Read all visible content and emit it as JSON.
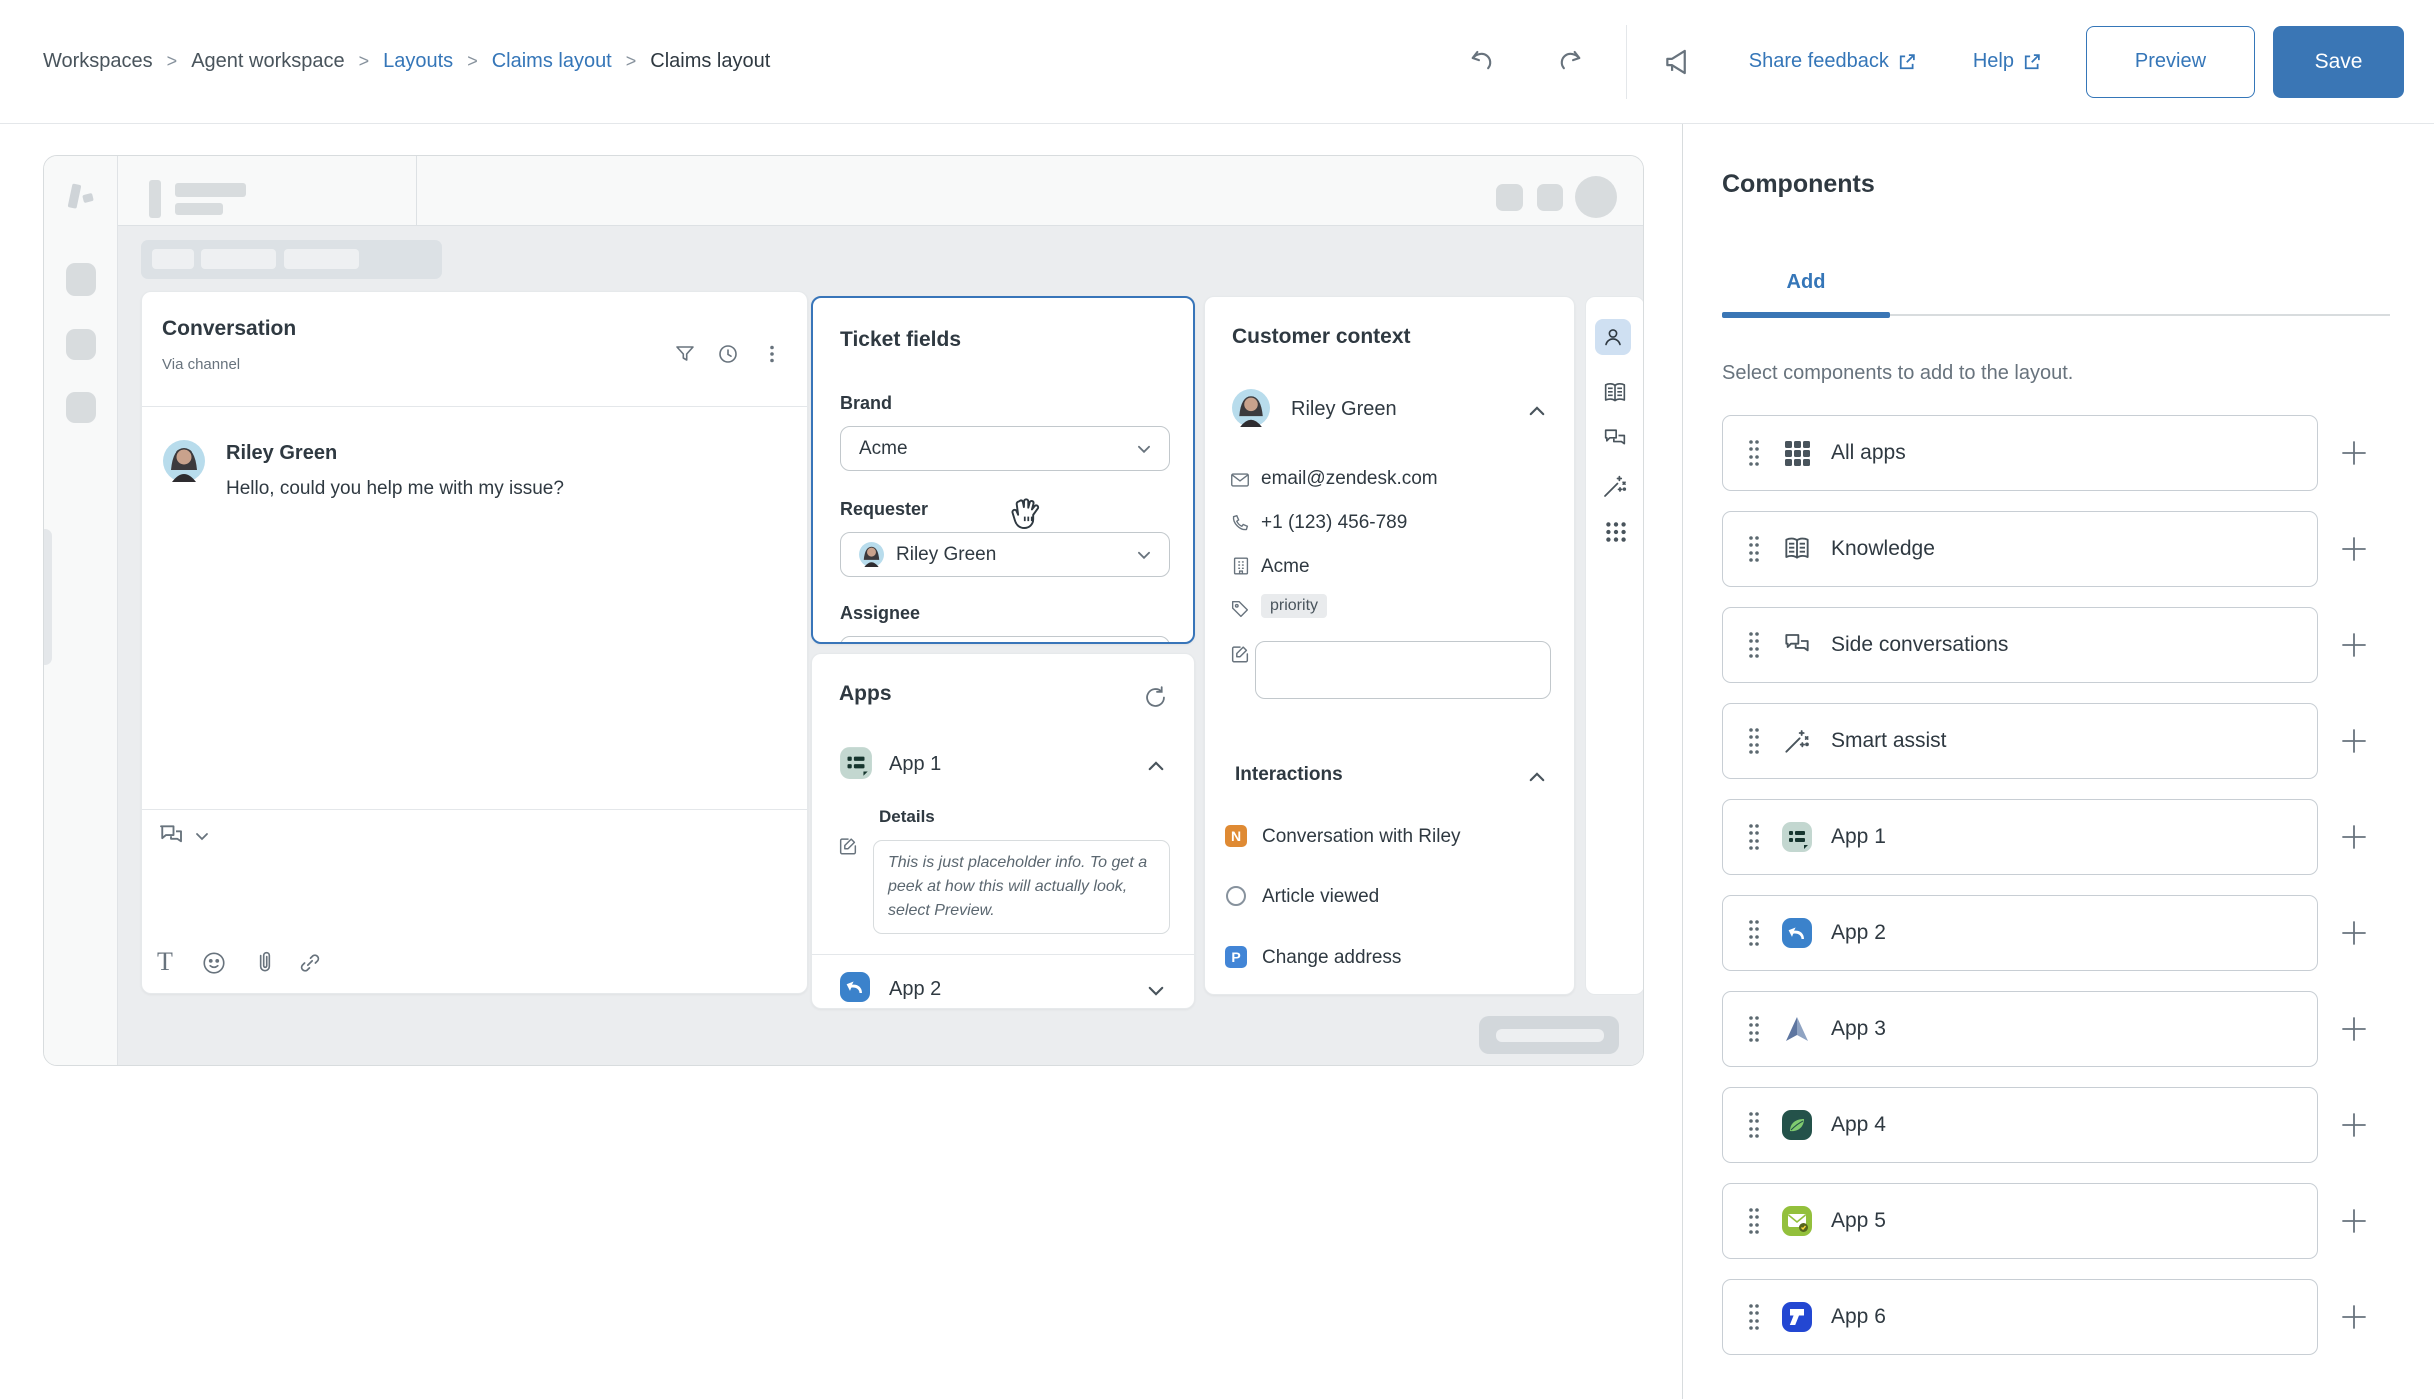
{
  "topbar": {
    "sep": ">",
    "breadcrumb": [
      {
        "label": "Workspaces"
      },
      {
        "label": "Agent workspace"
      },
      {
        "label": "Layouts"
      },
      {
        "label": "Claims layout"
      },
      {
        "label": "Claims layout"
      }
    ],
    "share_feedback": "Share feedback",
    "help": "Help",
    "preview": "Preview",
    "save": "Save"
  },
  "colors": {
    "accent": "#3a76b5",
    "selected_border": "#3875b9",
    "badge_n": "#df8a33",
    "badge_p": "#4285d6",
    "active_item_bg": "#cfe0f2"
  },
  "canvas": {
    "conversation": {
      "title": "Conversation",
      "via": "Via channel",
      "message_author": "Riley Green",
      "message_text": "Hello, could you help me with my issue?"
    },
    "ticket_fields": {
      "title": "Ticket fields",
      "brand_label": "Brand",
      "brand_value": "Acme",
      "requester_label": "Requester",
      "requester_value": "Riley Green",
      "assignee_label": "Assignee"
    },
    "apps": {
      "title": "Apps",
      "app1_label": "App 1",
      "details_label": "Details",
      "details_placeholder": "This is just placeholder info. To get a peek at how this will actually look, select Preview.",
      "app2_label": "App 2"
    },
    "customer": {
      "title": "Customer context",
      "name": "Riley Green",
      "email": "email@zendesk.com",
      "phone": "+1 (123) 456-789",
      "org": "Acme",
      "tag": "priority",
      "interactions_title": "Interactions",
      "interactions": [
        {
          "badge": "N",
          "label": "Conversation with Riley"
        },
        {
          "badge": "",
          "label": "Article viewed"
        },
        {
          "badge": "P",
          "label": "Change address"
        }
      ]
    }
  },
  "components": {
    "title": "Components",
    "tab": "Add",
    "description": "Select components to add to the layout.",
    "items": [
      {
        "label": "All apps",
        "icon": "all-apps-icon"
      },
      {
        "label": "Knowledge",
        "icon": "knowledge-icon"
      },
      {
        "label": "Side conversations",
        "icon": "side-conversations-icon"
      },
      {
        "label": "Smart assist",
        "icon": "smart-assist-icon"
      },
      {
        "label": "App 1",
        "icon": "app-1-icon"
      },
      {
        "label": "App 2",
        "icon": "app-2-icon"
      },
      {
        "label": "App 3",
        "icon": "app-3-icon"
      },
      {
        "label": "App 4",
        "icon": "app-4-icon"
      },
      {
        "label": "App 5",
        "icon": "app-5-icon"
      },
      {
        "label": "App 6",
        "icon": "app-6-icon"
      }
    ]
  }
}
